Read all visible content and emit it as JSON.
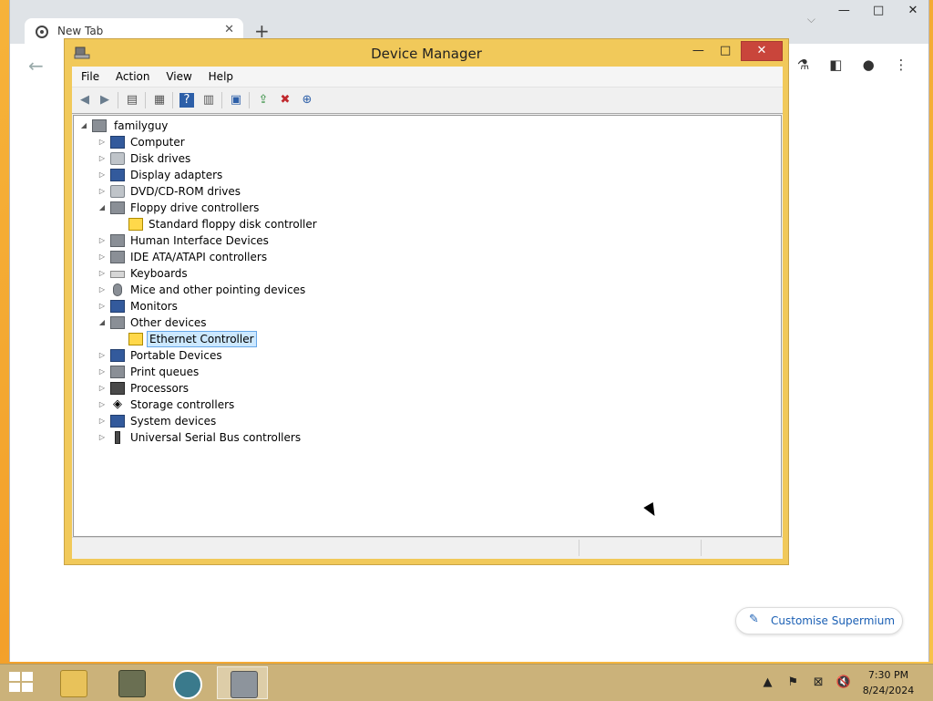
{
  "browser": {
    "tab_title": "New Tab",
    "tab_close": "✕",
    "new_tab": "+",
    "controls": {
      "minimize": "—",
      "maximize": "□",
      "close": "✕"
    },
    "tab_search": "⌵",
    "back": "←",
    "toolbar_icons": [
      "flask-icon",
      "sidepanel-icon",
      "profile-icon",
      "menu-icon"
    ],
    "customise_label": "Customise Supermium"
  },
  "device_manager": {
    "title": "Device Manager",
    "controls": {
      "minimize": "—",
      "maximize": "□",
      "close": "✕"
    },
    "menu": [
      "File",
      "Action",
      "View",
      "Help"
    ],
    "tree": {
      "root": "familyguy",
      "items": [
        {
          "label": "Computer",
          "icon": "computer-icon",
          "expanded": false
        },
        {
          "label": "Disk drives",
          "icon": "disk-drive-icon",
          "expanded": false
        },
        {
          "label": "Display adapters",
          "icon": "display-adapter-icon",
          "expanded": false
        },
        {
          "label": "DVD/CD-ROM drives",
          "icon": "dvd-drive-icon",
          "expanded": false
        },
        {
          "label": "Floppy drive controllers",
          "icon": "floppy-controller-icon",
          "expanded": true,
          "children": [
            {
              "label": "Standard floppy disk controller",
              "icon": "floppy-controller-icon"
            }
          ]
        },
        {
          "label": "Human Interface Devices",
          "icon": "hid-icon",
          "expanded": false
        },
        {
          "label": "IDE ATA/ATAPI controllers",
          "icon": "ide-controller-icon",
          "expanded": false
        },
        {
          "label": "Keyboards",
          "icon": "keyboard-icon",
          "expanded": false
        },
        {
          "label": "Mice and other pointing devices",
          "icon": "mouse-icon",
          "expanded": false
        },
        {
          "label": "Monitors",
          "icon": "monitor-icon",
          "expanded": false
        },
        {
          "label": "Other devices",
          "icon": "other-devices-icon",
          "expanded": true,
          "children": [
            {
              "label": "Ethernet Controller",
              "icon": "warning-device-icon",
              "selected": true
            }
          ]
        },
        {
          "label": "Portable Devices",
          "icon": "portable-device-icon",
          "expanded": false
        },
        {
          "label": "Print queues",
          "icon": "printer-icon",
          "expanded": false
        },
        {
          "label": "Processors",
          "icon": "processor-icon",
          "expanded": false
        },
        {
          "label": "Storage controllers",
          "icon": "storage-controller-icon",
          "expanded": false
        },
        {
          "label": "System devices",
          "icon": "system-device-icon",
          "expanded": false
        },
        {
          "label": "Universal Serial Bus controllers",
          "icon": "usb-icon",
          "expanded": false
        }
      ]
    }
  },
  "taskbar": {
    "clock_time": "7:30 PM",
    "clock_date": "8/24/2024",
    "tray": [
      "▲",
      "⚑",
      "⊠",
      "🔇"
    ]
  }
}
